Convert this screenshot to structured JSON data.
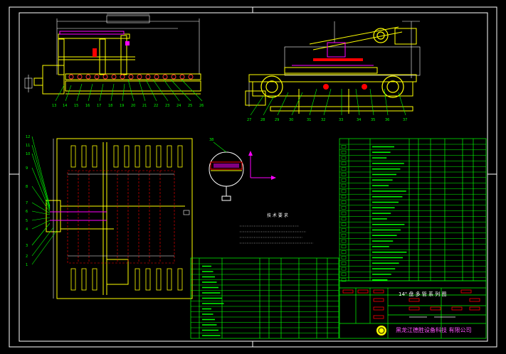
{
  "drawing": {
    "company": "黑龙江德胜设备科技 有限公司",
    "title_block_title": "14\" 盘 多 管 系 列 图",
    "tech_note": "技 术 要 求",
    "balloons_top_left": [
      "13",
      "14",
      "15",
      "16",
      "17",
      "18",
      "19",
      "20",
      "21",
      "22",
      "23",
      "24",
      "25",
      "26"
    ],
    "balloons_top_right": [
      "27",
      "28",
      "29",
      "30",
      "31",
      "32",
      "33",
      "34",
      "35",
      "36",
      "37"
    ],
    "balloons_plan_left": [
      "1",
      "2",
      "3",
      "4",
      "5",
      "6",
      "7",
      "8",
      "9",
      "10",
      "11",
      "12"
    ],
    "detail_label": "38",
    "colors": {
      "background": "#000000",
      "frame": "#ffffff",
      "machine": "#ffff00",
      "table": "#00ff00",
      "accent": "#ff00ff",
      "hidden": "#ff0000",
      "dimension": "#00ffff"
    }
  }
}
